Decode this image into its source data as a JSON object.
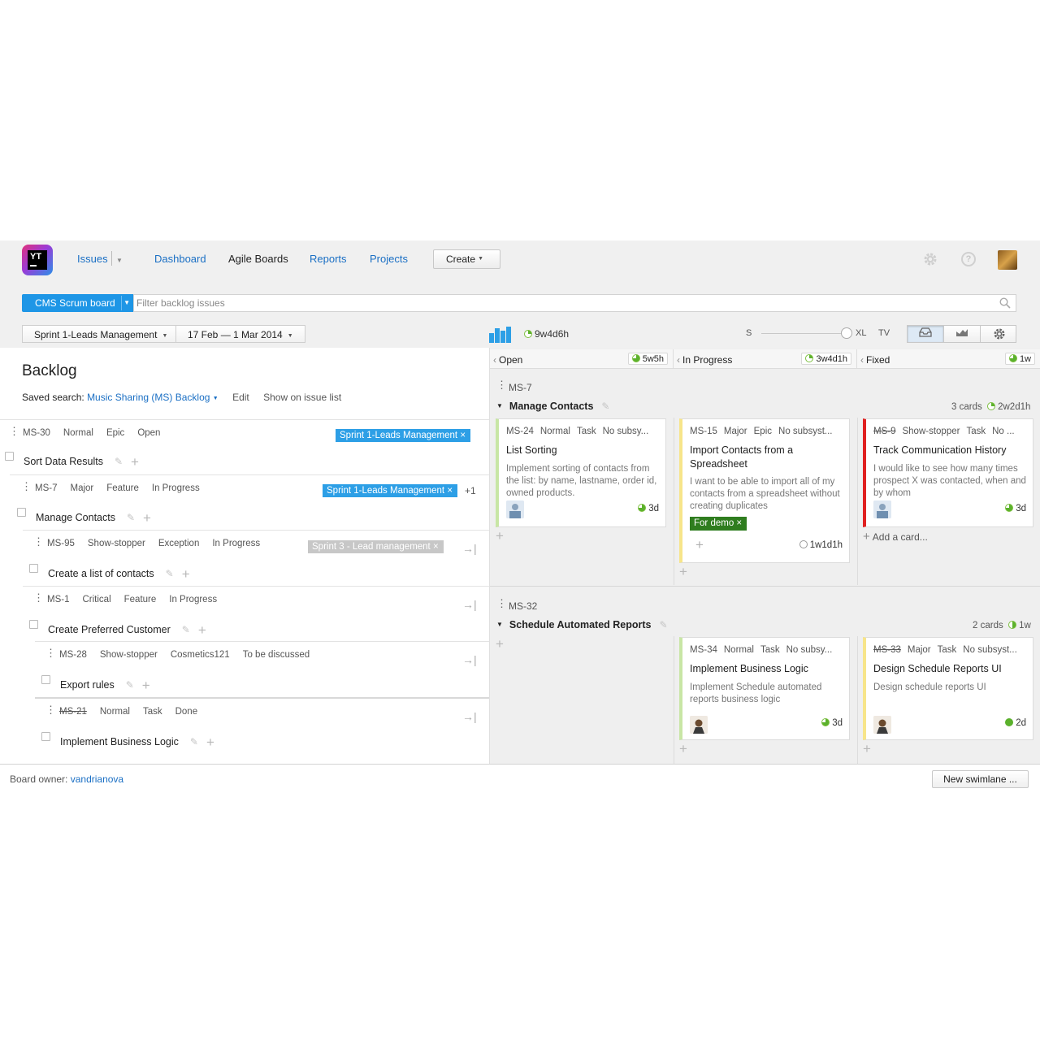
{
  "nav": {
    "issues": "Issues",
    "dashboard": "Dashboard",
    "agile_boards": "Agile Boards",
    "reports": "Reports",
    "projects": "Projects",
    "create": "Create",
    "logo_text": "YT"
  },
  "search": {
    "board": "CMS Scrum board",
    "placeholder": "Filter backlog issues"
  },
  "sprint": {
    "name": "Sprint 1-Leads Management",
    "dates": "17 Feb — 1 Mar 2014",
    "total_estimate": "9w4d6h"
  },
  "view": {
    "size_s": "S",
    "size_xl": "XL",
    "size_tv": "TV"
  },
  "backlog": {
    "title": "Backlog",
    "saved_search_label": "Saved search:",
    "saved_search_name": "Music Sharing (MS) Backlog",
    "edit": "Edit",
    "show_on_list": "Show on issue list",
    "items": [
      {
        "id": "MS-30",
        "priority": "Normal",
        "type": "Epic",
        "state": "Open",
        "summary": "Sort Data Results",
        "sprint": "Sprint 1-Leads Management"
      },
      {
        "id": "MS-7",
        "priority": "Major",
        "type": "Feature",
        "state": "In Progress",
        "summary": "Manage Contacts",
        "sprint": "Sprint 1-Leads Management",
        "extra": "+1"
      },
      {
        "id": "MS-95",
        "priority": "Show-stopper",
        "type": "Exception",
        "state": "In Progress",
        "summary": "Create a list of contacts",
        "sprint": "Sprint 3 - Lead management"
      },
      {
        "id": "MS-1",
        "priority": "Critical",
        "type": "Feature",
        "state": "In Progress",
        "summary": "Create Preferred Customer"
      },
      {
        "id": "MS-28",
        "priority": "Show-stopper",
        "type": "Cosmetics121",
        "state": "To be discussed",
        "summary": "Export rules"
      },
      {
        "id": "MS-21",
        "priority": "Normal",
        "type": "Task",
        "state": "Done",
        "summary": "Implement Business Logic"
      }
    ]
  },
  "footer": {
    "owner_label": "Board owner:",
    "owner": "vandrianova",
    "new_swimlane": "New swimlane ..."
  },
  "columns": [
    {
      "name": "Open",
      "estimate": "5w5h"
    },
    {
      "name": "In Progress",
      "estimate": "3w4d1h"
    },
    {
      "name": "Fixed",
      "estimate": "1w"
    }
  ],
  "swimlanes": [
    {
      "id": "MS-7",
      "title": "Manage Contacts",
      "count": "3 cards",
      "estimate": "2w2d1h",
      "cards": [
        {
          "id": "MS-24",
          "priority": "Normal",
          "type": "Task",
          "subsystem": "No subsy...",
          "title": "List Sorting",
          "desc": "Implement sorting of contacts from the list: by name, lastname, order id, owned products.",
          "estimate": "3d"
        },
        {
          "id": "MS-15",
          "priority": "Major",
          "type": "Epic",
          "subsystem": "No subsyst...",
          "title": "Import Contacts from a Spreadsheet",
          "desc": "I want to be able to import all of my contacts from a spreadsheet without creating duplicates",
          "tag": "For demo",
          "estimate": "1w1d1h"
        },
        {
          "id": "MS-9",
          "priority": "Show-stopper",
          "type": "Task",
          "subsystem": "No ...",
          "title": "Track Communication History",
          "desc": "I would like to see how many times prospect X was contacted, when and by whom",
          "estimate": "3d"
        }
      ],
      "add_card": "Add a card..."
    },
    {
      "id": "MS-32",
      "title": "Schedule Automated Reports",
      "count": "2 cards",
      "estimate": "1w",
      "cards": [
        {
          "id": "MS-34",
          "priority": "Normal",
          "type": "Task",
          "subsystem": "No subsy...",
          "title": "Implement Business Logic",
          "desc": "Implement Schedule automated reports business logic",
          "estimate": "3d"
        },
        {
          "id": "MS-33",
          "priority": "Major",
          "type": "Task",
          "subsystem": "No subsyst...",
          "title": "Design Schedule Reports UI",
          "desc": "Design schedule reports UI",
          "estimate": "2d"
        }
      ]
    }
  ]
}
